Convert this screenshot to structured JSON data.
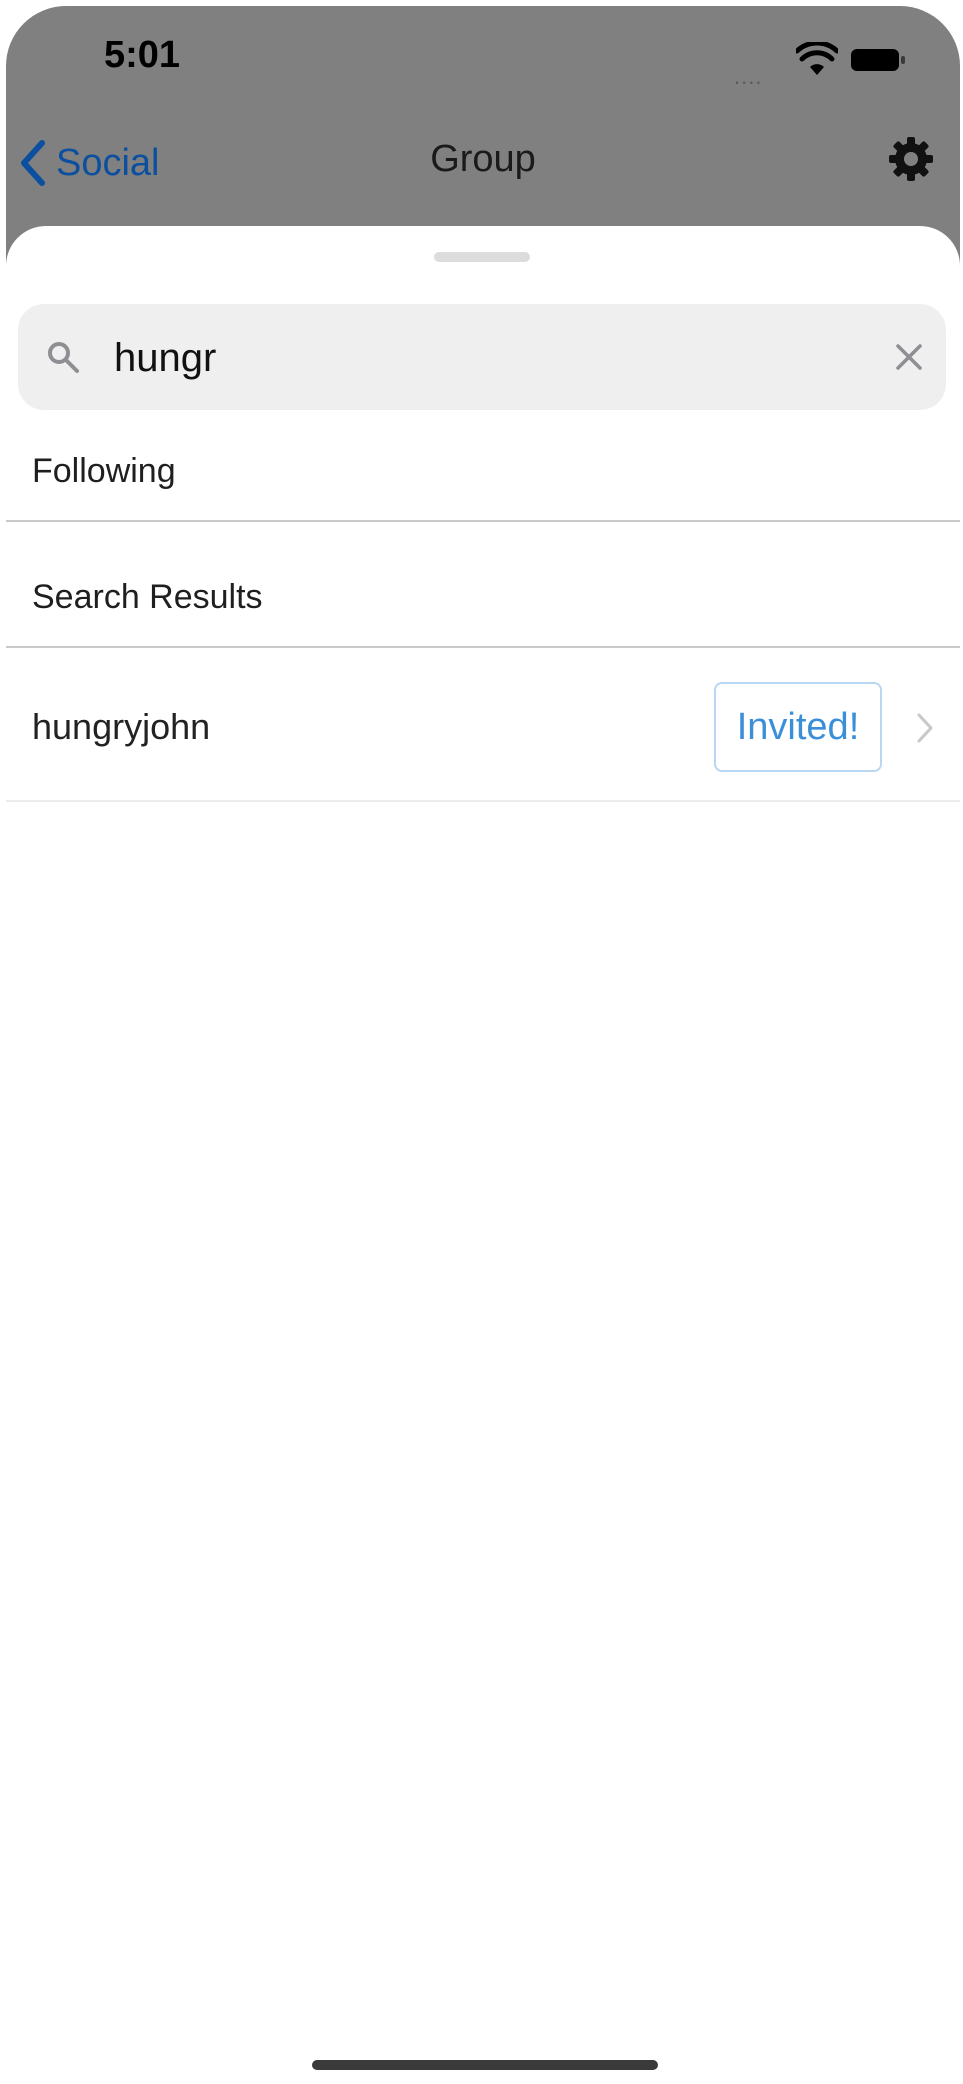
{
  "status_bar": {
    "time": "5:01",
    "signal": "....",
    "icons": [
      "wifi-icon",
      "battery-icon"
    ]
  },
  "nav": {
    "back_label": "Social",
    "title": "Group",
    "settings_icon": "gear-icon"
  },
  "search": {
    "value": "hungr",
    "icon": "search-icon",
    "clear_icon": "close-icon"
  },
  "sections": {
    "following": "Following",
    "search_results": "Search Results"
  },
  "results": [
    {
      "username": "hungryjohn",
      "action_label": "Invited!"
    }
  ],
  "colors": {
    "accent": "#0b4f9e",
    "invited_text": "#3b8fd9",
    "dim_background": "#808080",
    "search_background": "#efefef"
  }
}
